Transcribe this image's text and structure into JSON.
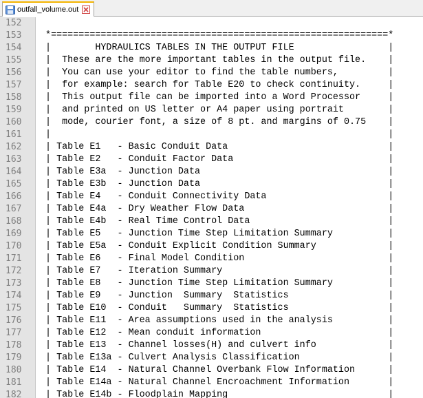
{
  "tab": {
    "filename": "outfall_volume.out",
    "icon": "save-disk-icon",
    "close_icon": "close-icon",
    "close_color": "#d04040"
  },
  "editor": {
    "lines": [
      {
        "num": "152",
        "text": ""
      },
      {
        "num": "153",
        "text": " *=============================================================*"
      },
      {
        "num": "154",
        "text": " |        HYDRAULICS TABLES IN THE OUTPUT FILE                 |"
      },
      {
        "num": "155",
        "text": " |  These are the more important tables in the output file.    |"
      },
      {
        "num": "156",
        "text": " |  You can use your editor to find the table numbers,         |"
      },
      {
        "num": "157",
        "text": " |  for example: search for Table E20 to check continuity.     |"
      },
      {
        "num": "158",
        "text": " |  This output file can be imported into a Word Processor     |"
      },
      {
        "num": "159",
        "text": " |  and printed on US letter or A4 paper using portrait        |"
      },
      {
        "num": "160",
        "text": " |  mode, courier font, a size of 8 pt. and margins of 0.75    |"
      },
      {
        "num": "161",
        "text": " |                                                             |"
      },
      {
        "num": "162",
        "text": " | Table E1   - Basic Conduit Data                             |"
      },
      {
        "num": "163",
        "text": " | Table E2   - Conduit Factor Data                            |"
      },
      {
        "num": "164",
        "text": " | Table E3a  - Junction Data                                  |"
      },
      {
        "num": "165",
        "text": " | Table E3b  - Junction Data                                  |"
      },
      {
        "num": "166",
        "text": " | Table E4   - Conduit Connectivity Data                      |"
      },
      {
        "num": "167",
        "text": " | Table E4a  - Dry Weather Flow Data                          |"
      },
      {
        "num": "168",
        "text": " | Table E4b  - Real Time Control Data                         |"
      },
      {
        "num": "169",
        "text": " | Table E5   - Junction Time Step Limitation Summary          |"
      },
      {
        "num": "170",
        "text": " | Table E5a  - Conduit Explicit Condition Summary             |"
      },
      {
        "num": "171",
        "text": " | Table E6   - Final Model Condition                          |"
      },
      {
        "num": "172",
        "text": " | Table E7   - Iteration Summary                              |"
      },
      {
        "num": "173",
        "text": " | Table E8   - Junction Time Step Limitation Summary          |"
      },
      {
        "num": "174",
        "text": " | Table E9   - Junction  Summary  Statistics                  |"
      },
      {
        "num": "175",
        "text": " | Table E10  - Conduit   Summary  Statistics                  |"
      },
      {
        "num": "176",
        "text": " | Table E11  - Area assumptions used in the analysis          |"
      },
      {
        "num": "177",
        "text": " | Table E12  - Mean conduit information                       |"
      },
      {
        "num": "178",
        "text": " | Table E13  - Channel losses(H) and culvert info             |"
      },
      {
        "num": "179",
        "text": " | Table E13a - Culvert Analysis Classification                |"
      },
      {
        "num": "180",
        "text": " | Table E14  - Natural Channel Overbank Flow Information      |"
      },
      {
        "num": "181",
        "text": " | Table E14a - Natural Channel Encroachment Information       |"
      },
      {
        "num": "182",
        "text": " | Table E14b - Floodplain Mapping                             |"
      }
    ]
  }
}
